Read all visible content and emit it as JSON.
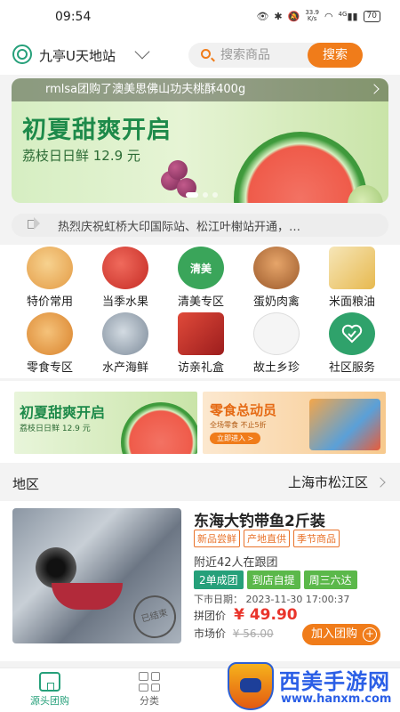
{
  "status_bar": {
    "time": "09:54",
    "network_speed_top": "33.9",
    "network_speed_bottom": "K/s",
    "signal_label": "4G",
    "battery": "70"
  },
  "header": {
    "station_name": "九亭U天地站",
    "search_placeholder": "搜索商品",
    "search_button": "搜索"
  },
  "banner": {
    "ticker_text": "rmlsa团购了澳美思佛山功夫桃酥400g",
    "title": "初夏甜爽开启",
    "subtitle": "荔枝日日鲜 12.9 元"
  },
  "notice": {
    "text": "热烈庆祝虹桥大印国际站、松江叶榭站开通，…"
  },
  "categories": [
    {
      "label": "特价常用",
      "icon": "discount-goods-icon",
      "color": "#f2b56b"
    },
    {
      "label": "当季水果",
      "icon": "apple-fruit-icon",
      "color": "#d9413a"
    },
    {
      "label": "清美专区",
      "icon": "qingmei-brand-icon",
      "color": "#3aa55a",
      "badge": "清美"
    },
    {
      "label": "蛋奶肉禽",
      "icon": "chicken-icon",
      "color": "#c57b3d"
    },
    {
      "label": "米面粮油",
      "icon": "rice-oil-icon",
      "color": "#e7b94f"
    },
    {
      "label": "零食专区",
      "icon": "snack-icon",
      "color": "#e8a34c"
    },
    {
      "label": "水产海鲜",
      "icon": "fish-icon",
      "color": "#8a9aa8"
    },
    {
      "label": "访亲礼盒",
      "icon": "gift-box-icon",
      "color": "#c22e2e"
    },
    {
      "label": "故土乡珍",
      "icon": "hometown-product-icon",
      "color": "#333333"
    },
    {
      "label": "社区服务",
      "icon": "community-service-icon",
      "color": "#2fa26b"
    }
  ],
  "promos": {
    "left": {
      "title": "初夏甜爽开启",
      "subtitle": "荔枝日日鲜 12.9 元"
    },
    "right": {
      "title": "零食总动员",
      "subtitle": "全场零食 不止5折",
      "button": "立即进入 >"
    }
  },
  "region": {
    "label": "地区",
    "value": "上海市松江区"
  },
  "product": {
    "title": "东海大钓带鱼2斤装",
    "tags": [
      "新品尝鲜",
      "产地直供",
      "季节商品"
    ],
    "followers": "附近42人在跟团",
    "badges": [
      "2单成团",
      "到店自提",
      "周三六达"
    ],
    "deadline_label": "下市日期：",
    "deadline_time": "2023-11-30 17:00:37",
    "group_price_label": "拼团价",
    "group_price": "¥ 49.90",
    "market_price_label": "市场价",
    "market_price": "¥ 56.00",
    "add_button": "加入团购",
    "stamp_text": "已结束"
  },
  "tabbar": {
    "tabs": [
      {
        "label": "源头团购",
        "active": true
      },
      {
        "label": "分类",
        "active": false
      }
    ]
  },
  "watermark": {
    "name": "西美手游网",
    "url": "www.hanxm.com"
  },
  "colors": {
    "brand_green": "#26a07a",
    "accent_orange": "#f07c1a",
    "price_red": "#e9342b"
  }
}
